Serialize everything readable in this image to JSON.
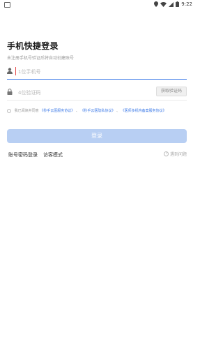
{
  "status_bar": {
    "time": "9:22"
  },
  "login": {
    "title": "手机快捷登录",
    "subtitle": "未注册手机号验证后将自动创建账号",
    "phone_placeholder": "1位手机号",
    "code_placeholder": "4位验证码",
    "get_code_label": "获取验证码"
  },
  "agreement": {
    "prefix": "我已阅读并同意",
    "link1": "《秒手云医服务协议》",
    "sep1": "、",
    "link2": "《秒手云医隐私协议》",
    "sep2": "、",
    "link3": "《医师多机构备案服务协议》",
    "link_color": "#3a78e7"
  },
  "actions": {
    "login_label": "登录",
    "password_login": "账号密码登录",
    "guest_mode": "访客模式",
    "help": "遇到问题"
  }
}
